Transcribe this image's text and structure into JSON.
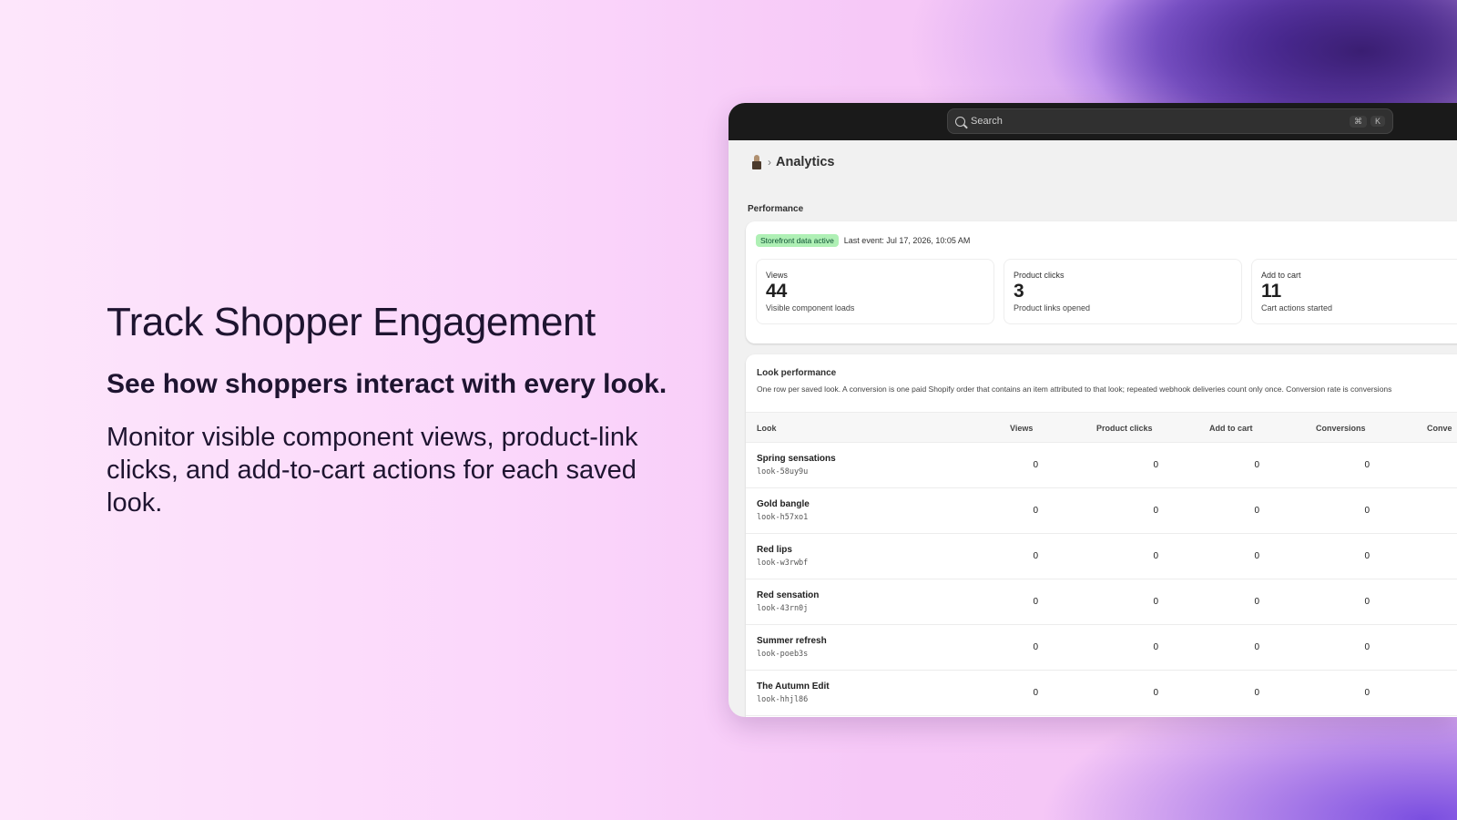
{
  "hero": {
    "title": "Track Shopper Engagement",
    "subtitle": "See how shoppers interact with every look.",
    "body": "Monitor visible component views, product-link clicks, and add-to-cart actions for each saved look."
  },
  "topbar": {
    "search_placeholder": "Search",
    "shortcut_key1": "⌘",
    "shortcut_key2": "K"
  },
  "breadcrumb": {
    "title": "Analytics"
  },
  "performance": {
    "label": "Performance",
    "badge": "Storefront data active",
    "last_event": "Last event: Jul 17, 2026, 10:05 AM",
    "metrics": [
      {
        "label": "Views",
        "value": "44",
        "desc": "Visible component loads"
      },
      {
        "label": "Product clicks",
        "value": "3",
        "desc": "Product links opened"
      },
      {
        "label": "Add to cart",
        "value": "11",
        "desc": "Cart actions started"
      }
    ]
  },
  "look_performance": {
    "title": "Look performance",
    "description": "One row per saved look. A conversion is one paid Shopify order that contains an item attributed to that look; repeated webhook deliveries count only once. Conversion rate is conversions",
    "columns": [
      "Look",
      "Views",
      "Product clicks",
      "Add to cart",
      "Conversions",
      "Conve"
    ],
    "rows": [
      {
        "name": "Spring sensations",
        "id": "look-58uy9u",
        "views": "0",
        "clicks": "0",
        "cart": "0",
        "conversions": "0"
      },
      {
        "name": "Gold bangle",
        "id": "look-h57xo1",
        "views": "0",
        "clicks": "0",
        "cart": "0",
        "conversions": "0"
      },
      {
        "name": "Red lips",
        "id": "look-w3rwbf",
        "views": "0",
        "clicks": "0",
        "cart": "0",
        "conversions": "0"
      },
      {
        "name": "Red sensation",
        "id": "look-43rn0j",
        "views": "0",
        "clicks": "0",
        "cart": "0",
        "conversions": "0"
      },
      {
        "name": "Summer refresh",
        "id": "look-poeb3s",
        "views": "0",
        "clicks": "0",
        "cart": "0",
        "conversions": "0"
      },
      {
        "name": "The Autumn Edit",
        "id": "look-hhjl86",
        "views": "0",
        "clicks": "0",
        "cart": "0",
        "conversions": "0"
      }
    ]
  },
  "colors": {
    "accent_purple": "#6a3fd8",
    "badge_green_bg": "#aff0b5",
    "badge_green_text": "#0c5132",
    "topbar_bg": "#1a1a1a"
  }
}
